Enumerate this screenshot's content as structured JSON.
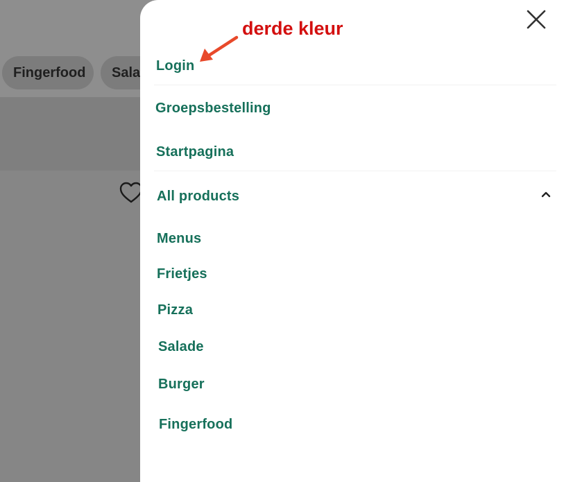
{
  "background": {
    "chips": [
      {
        "label": "Fingerfood"
      },
      {
        "label": "Salat"
      }
    ],
    "heart_icon": "heart-outline-icon"
  },
  "drawer": {
    "close_icon": "close-icon",
    "items": [
      {
        "label": "Login"
      },
      {
        "label": "Groepsbestelling"
      },
      {
        "label": "Startpagina"
      },
      {
        "label": "All products"
      }
    ],
    "expand_icon": "chevron-up-icon",
    "subitems": [
      {
        "label": "Menus"
      },
      {
        "label": "Frietjes"
      },
      {
        "label": "Pizza"
      },
      {
        "label": "Salade"
      },
      {
        "label": "Burger"
      },
      {
        "label": "Fingerfood"
      }
    ]
  },
  "annotation": {
    "text": "derde kleur",
    "color": "#d30f0f",
    "arrow_color": "#e8492a"
  },
  "colors": {
    "menu_text": "#16705a",
    "overlay": "#8a8a8a",
    "drawer_bg": "#ffffff"
  }
}
